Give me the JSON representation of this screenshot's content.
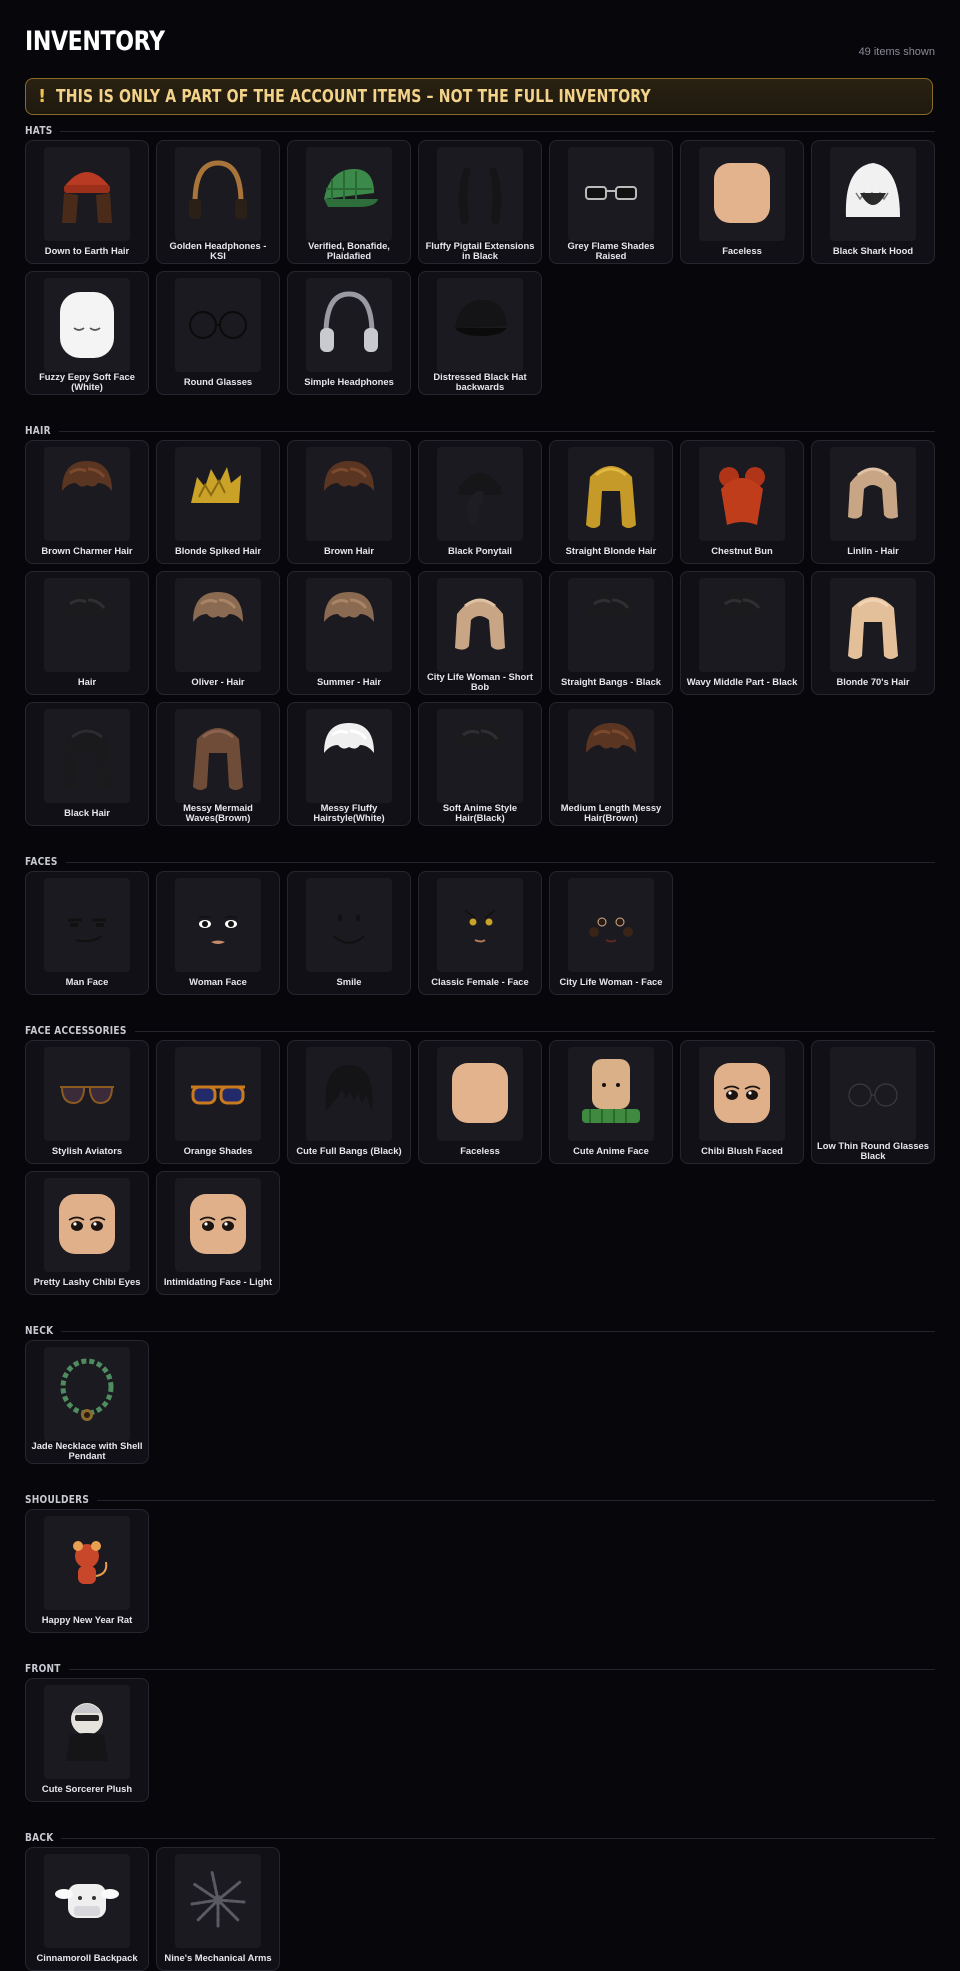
{
  "header": {
    "title": "INVENTORY",
    "count": "49 items shown"
  },
  "notice": {
    "icon": "!",
    "text": "THIS IS ONLY A PART OF THE ACCOUNT ITEMS – NOT THE FULL INVENTORY"
  },
  "sections": [
    {
      "label": "HATS",
      "items": [
        {
          "name": "Down to Earth Hair",
          "icon": "beanie-hair-icon"
        },
        {
          "name": "Golden Headphones - KSI",
          "icon": "headphones-gold-icon"
        },
        {
          "name": "Verified, Bonafide, Plaidafied",
          "icon": "plaid-cap-icon"
        },
        {
          "name": "Fluffy Pigtail Extensions in Black",
          "icon": "pigtails-icon"
        },
        {
          "name": "Grey Flame Shades Raised",
          "icon": "shades-icon"
        },
        {
          "name": "Faceless",
          "icon": "skin-head-icon"
        },
        {
          "name": "Black Shark Hood",
          "icon": "shark-hood-icon"
        },
        {
          "name": "Fuzzy Eepy Soft Face (White)",
          "icon": "white-mask-icon"
        },
        {
          "name": "Round Glasses",
          "icon": "round-glasses-icon"
        },
        {
          "name": "Simple Headphones",
          "icon": "headphones-grey-icon"
        },
        {
          "name": "Distressed Black Hat backwards",
          "icon": "black-cap-icon"
        }
      ]
    },
    {
      "label": "HAIR",
      "items": [
        {
          "name": "Brown Charmer Hair",
          "icon": "hair-brown-icon"
        },
        {
          "name": "Blonde Spiked Hair",
          "icon": "hair-spiky-blonde-icon"
        },
        {
          "name": "Brown Hair",
          "icon": "hair-brown-icon"
        },
        {
          "name": "Black Ponytail",
          "icon": "hair-ponytail-icon"
        },
        {
          "name": "Straight Blonde Hair",
          "icon": "hair-long-blonde-icon"
        },
        {
          "name": "Chestnut Bun",
          "icon": "hair-red-bun-icon"
        },
        {
          "name": "Linlin - Hair",
          "icon": "hair-bob-light-icon"
        },
        {
          "name": "Hair",
          "icon": "hair-dark-icon"
        },
        {
          "name": "Oliver - Hair",
          "icon": "hair-light-brown-icon"
        },
        {
          "name": "Summer - Hair",
          "icon": "hair-light-brown-icon"
        },
        {
          "name": "City Life Woman - Short Bob",
          "icon": "hair-bob-light-icon"
        },
        {
          "name": "Straight Bangs - Black",
          "icon": "hair-dark-icon"
        },
        {
          "name": "Wavy Middle Part - Black",
          "icon": "hair-dark-icon"
        },
        {
          "name": "Blonde 70's Hair",
          "icon": "hair-wavy-blonde-icon"
        },
        {
          "name": "Black Hair",
          "icon": "hair-long-dark-icon"
        },
        {
          "name": "Messy Mermaid Waves(Brown)",
          "icon": "hair-wavy-brown-icon"
        },
        {
          "name": "Messy Fluffy Hairstyle(White)",
          "icon": "hair-white-icon"
        },
        {
          "name": "Soft Anime Style Hair(Black)",
          "icon": "hair-dark-icon"
        },
        {
          "name": "Medium Length Messy Hair(Brown)",
          "icon": "hair-brown-icon"
        }
      ]
    },
    {
      "label": "FACES",
      "items": [
        {
          "name": "Man Face",
          "icon": "man-face-icon"
        },
        {
          "name": "Woman Face",
          "icon": "woman-face-icon"
        },
        {
          "name": "Smile",
          "icon": "smile-face-icon"
        },
        {
          "name": "Classic Female - Face",
          "icon": "female-face-icon"
        },
        {
          "name": "City Life Woman - Face",
          "icon": "city-face-icon"
        }
      ]
    },
    {
      "label": "FACE ACCESSORIES",
      "items": [
        {
          "name": "Stylish Aviators",
          "icon": "aviators-icon"
        },
        {
          "name": "Orange Shades",
          "icon": "orange-shades-icon"
        },
        {
          "name": "Cute Full Bangs (Black)",
          "icon": "bangs-icon"
        },
        {
          "name": "Faceless",
          "icon": "skin-head-icon"
        },
        {
          "name": "Cute Anime Face",
          "icon": "anime-face-icon"
        },
        {
          "name": "Chibi Blush Faced",
          "icon": "chibi-face-icon"
        },
        {
          "name": "Low Thin Round Glasses Black",
          "icon": "thin-glasses-icon"
        },
        {
          "name": "Pretty Lashy Chibi Eyes",
          "icon": "chibi-face-icon"
        },
        {
          "name": "Intimidating Face - Light",
          "icon": "chibi-face-icon"
        }
      ]
    },
    {
      "label": "NECK",
      "items": [
        {
          "name": "Jade Necklace with Shell Pendant",
          "icon": "necklace-icon"
        }
      ]
    },
    {
      "label": "SHOULDERS",
      "items": [
        {
          "name": "Happy New Year Rat",
          "icon": "rat-icon"
        }
      ]
    },
    {
      "label": "FRONT",
      "items": [
        {
          "name": "Cute Sorcerer Plush",
          "icon": "plush-icon"
        }
      ]
    },
    {
      "label": "BACK",
      "items": [
        {
          "name": "Cinnamoroll Backpack",
          "icon": "backpack-icon"
        },
        {
          "name": "Nine's Mechanical Arms",
          "icon": "mech-arms-icon"
        }
      ]
    }
  ]
}
